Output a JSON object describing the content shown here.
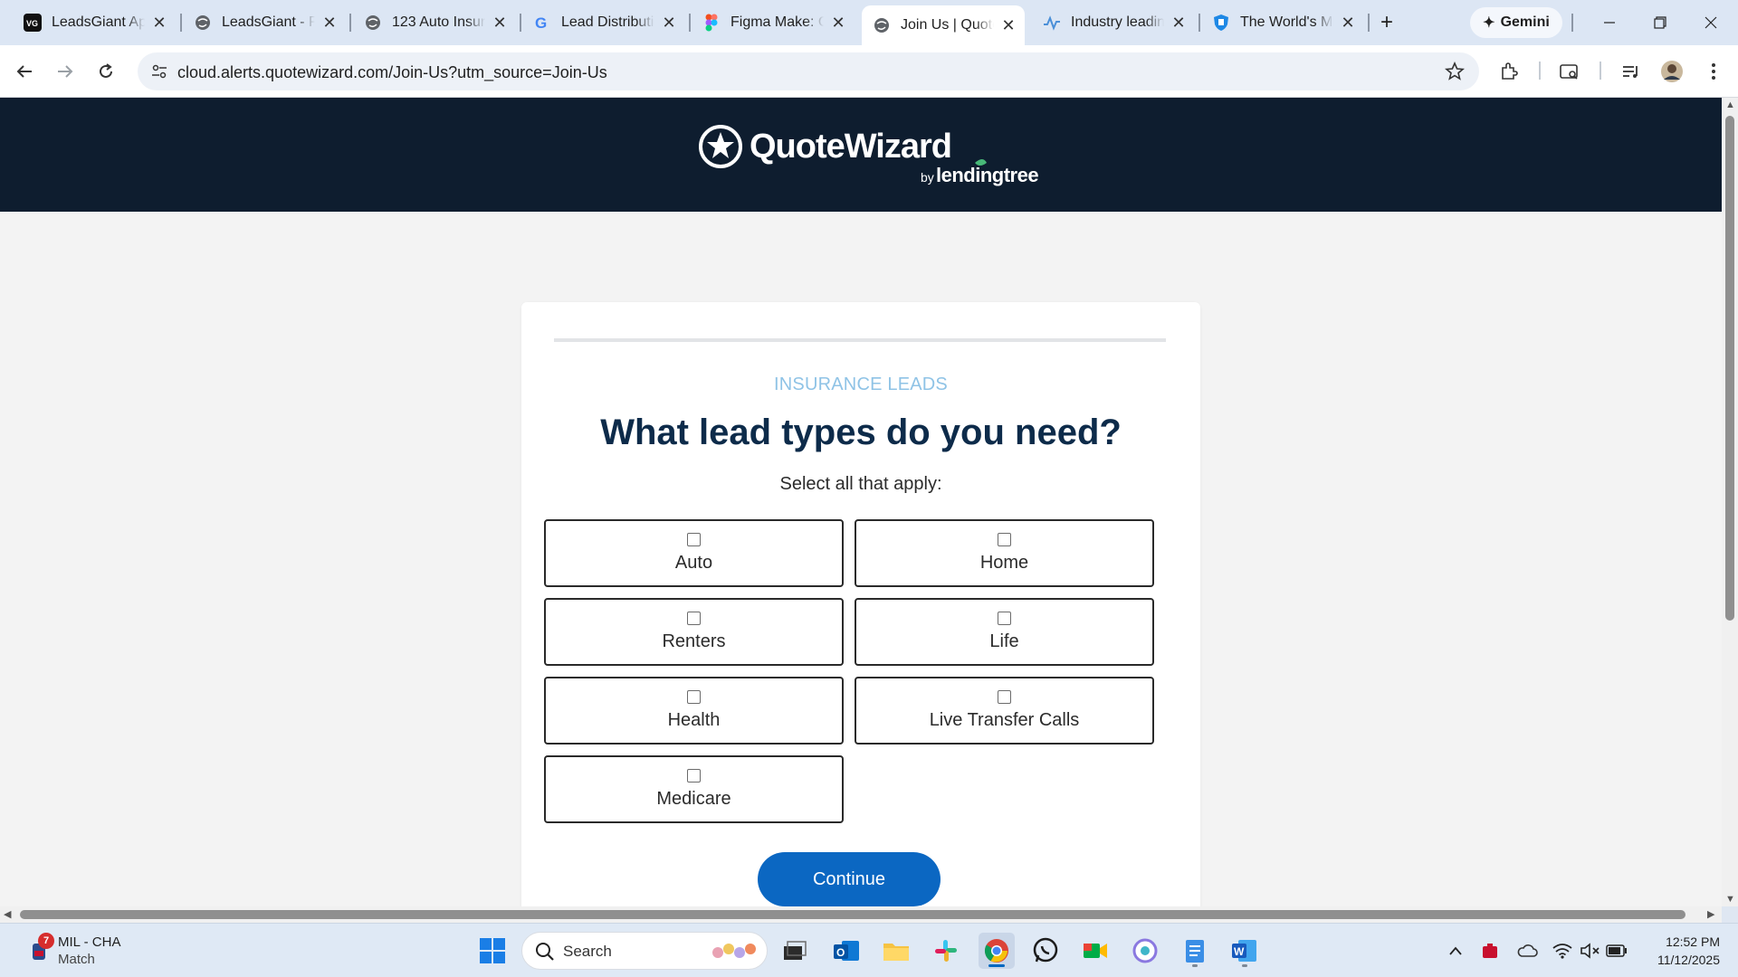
{
  "browser": {
    "tabs": [
      {
        "title": "LeadsGiant Api",
        "icon": "leadsgiant-icon"
      },
      {
        "title": "LeadsGiant - Pr",
        "icon": "globe-icon"
      },
      {
        "title": "123 Auto Insura",
        "icon": "globe-icon"
      },
      {
        "title": "Lead Distributio",
        "icon": "google-icon"
      },
      {
        "title": "Figma Make: Ch",
        "icon": "figma-icon"
      },
      {
        "title": "Join Us | Quote",
        "icon": "globe-icon",
        "active": true
      },
      {
        "title": "Industry leadin",
        "icon": "activity-icon"
      },
      {
        "title": "The World's Mo",
        "icon": "shield-icon"
      }
    ],
    "gemini_label": "Gemini",
    "url": "cloud.alerts.quotewizard.com/Join-Us?utm_source=Join-Us"
  },
  "page": {
    "brand": {
      "name": "QuoteWizard",
      "by": "by",
      "partner": "lendingtree"
    },
    "eyebrow": "INSURANCE LEADS",
    "heading": "What lead types do you need?",
    "subheading": "Select all that apply:",
    "options": [
      {
        "label": "Auto",
        "checked": false
      },
      {
        "label": "Home",
        "checked": false
      },
      {
        "label": "Renters",
        "checked": false
      },
      {
        "label": "Life",
        "checked": false
      },
      {
        "label": "Health",
        "checked": false
      },
      {
        "label": "Live Transfer Calls",
        "checked": false
      },
      {
        "label": "Medicare",
        "checked": false
      }
    ],
    "continue_label": "Continue"
  },
  "taskbar": {
    "weather": {
      "badge": "7",
      "line1": "MIL - CHA",
      "line2": "Match"
    },
    "search_label": "Search",
    "time": "12:52 PM",
    "date": "11/12/2025"
  },
  "colors": {
    "hero_bg": "#0e1d2f",
    "accent_blue": "#0b67c2",
    "eyebrow": "#8fc3e6",
    "heading": "#0d2b4a"
  }
}
